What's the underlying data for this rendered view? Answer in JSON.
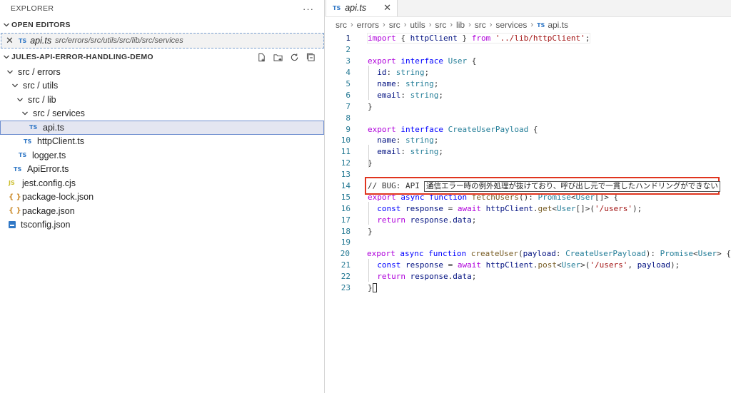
{
  "sidebar": {
    "title": "EXPLORER",
    "more_label": "···",
    "open_editors": {
      "title": "OPEN EDITORS",
      "item": {
        "close": "✕",
        "badge": "TS",
        "name": "api.ts",
        "path": "src/errors/src/utils/src/lib/src/services"
      }
    },
    "project": {
      "title": "JULES-API-ERROR-HANDLING-DEMO",
      "tree": [
        {
          "label": "src / errors",
          "type": "folder",
          "indent": 1
        },
        {
          "label": "src / utils",
          "type": "folder",
          "indent": 2
        },
        {
          "label": "src / lib",
          "type": "folder",
          "indent": 3
        },
        {
          "label": "src / services",
          "type": "folder",
          "indent": 4
        },
        {
          "label": "api.ts",
          "type": "ts",
          "indent": 5,
          "selected": true
        },
        {
          "label": "httpClient.ts",
          "type": "ts",
          "indent": 4
        },
        {
          "label": "logger.ts",
          "type": "ts",
          "indent": 3
        },
        {
          "label": "ApiError.ts",
          "type": "ts",
          "indent": 2
        },
        {
          "label": "jest.config.cjs",
          "type": "js",
          "indent": 1
        },
        {
          "label": "package-lock.json",
          "type": "json",
          "indent": 1
        },
        {
          "label": "package.json",
          "type": "json",
          "indent": 1
        },
        {
          "label": "tsconfig.json",
          "type": "tsconfig",
          "indent": 1
        }
      ]
    }
  },
  "editor": {
    "tab": {
      "badge": "TS",
      "label": "api.ts",
      "close": "✕"
    },
    "breadcrumb": [
      "src",
      "errors",
      "src",
      "utils",
      "src",
      "lib",
      "src",
      "services",
      "api.ts"
    ],
    "breadcrumb_badge": "TS",
    "comment_overlay": "通信エラー時の例外処理が抜けており、呼び出し元で一貫したハンドリングができない",
    "lines": [
      [
        [
          "kw",
          "import"
        ],
        [
          "pu",
          " { "
        ],
        [
          "id",
          "httpClient"
        ],
        [
          "pu",
          " } "
        ],
        [
          "kw",
          "from"
        ],
        [
          "pu",
          " "
        ],
        [
          "str",
          "'../lib/httpClient'"
        ],
        [
          "pu",
          ";"
        ]
      ],
      [],
      [
        [
          "kw",
          "export"
        ],
        [
          "pu",
          " "
        ],
        [
          "kw2",
          "interface"
        ],
        [
          "pu",
          " "
        ],
        [
          "ty",
          "User"
        ],
        [
          "pu",
          " {"
        ]
      ],
      [
        [
          "pu",
          "  "
        ],
        [
          "id",
          "id"
        ],
        [
          "pu",
          ": "
        ],
        [
          "ty",
          "string"
        ],
        [
          "pu",
          ";"
        ]
      ],
      [
        [
          "pu",
          "  "
        ],
        [
          "id",
          "name"
        ],
        [
          "pu",
          ": "
        ],
        [
          "ty",
          "string"
        ],
        [
          "pu",
          ";"
        ]
      ],
      [
        [
          "pu",
          "  "
        ],
        [
          "id",
          "email"
        ],
        [
          "pu",
          ": "
        ],
        [
          "ty",
          "string"
        ],
        [
          "pu",
          ";"
        ]
      ],
      [
        [
          "pu",
          "}"
        ]
      ],
      [],
      [
        [
          "kw",
          "export"
        ],
        [
          "pu",
          " "
        ],
        [
          "kw2",
          "interface"
        ],
        [
          "pu",
          " "
        ],
        [
          "ty",
          "CreateUserPayload"
        ],
        [
          "pu",
          " {"
        ]
      ],
      [
        [
          "pu",
          "  "
        ],
        [
          "id",
          "name"
        ],
        [
          "pu",
          ": "
        ],
        [
          "ty",
          "string"
        ],
        [
          "pu",
          ";"
        ]
      ],
      [
        [
          "pu",
          "  "
        ],
        [
          "id",
          "email"
        ],
        [
          "pu",
          ": "
        ],
        [
          "ty",
          "string"
        ],
        [
          "pu",
          ";"
        ]
      ],
      [
        [
          "pu",
          "}"
        ]
      ],
      [],
      [
        [
          "cm",
          "// BUG: API "
        ]
      ],
      [
        [
          "kw",
          "export"
        ],
        [
          "pu",
          " "
        ],
        [
          "kw2",
          "async"
        ],
        [
          "pu",
          " "
        ],
        [
          "kw2",
          "function"
        ],
        [
          "pu",
          " "
        ],
        [
          "fn",
          "fetchUsers"
        ],
        [
          "pu",
          "(): "
        ],
        [
          "ty",
          "Promise"
        ],
        [
          "pu",
          "<"
        ],
        [
          "ty",
          "User"
        ],
        [
          "pu",
          "[]> {"
        ]
      ],
      [
        [
          "pu",
          "  "
        ],
        [
          "kw2",
          "const"
        ],
        [
          "pu",
          " "
        ],
        [
          "id",
          "response"
        ],
        [
          "pu",
          " = "
        ],
        [
          "kw",
          "await"
        ],
        [
          "pu",
          " "
        ],
        [
          "id",
          "httpClient"
        ],
        [
          "pu",
          "."
        ],
        [
          "fn",
          "get"
        ],
        [
          "pu",
          "<"
        ],
        [
          "ty",
          "User"
        ],
        [
          "pu",
          "[]>("
        ],
        [
          "str",
          "'/users'"
        ],
        [
          "pu",
          ");"
        ]
      ],
      [
        [
          "pu",
          "  "
        ],
        [
          "kw",
          "return"
        ],
        [
          "pu",
          " "
        ],
        [
          "id",
          "response"
        ],
        [
          "pu",
          "."
        ],
        [
          "id",
          "data"
        ],
        [
          "pu",
          ";"
        ]
      ],
      [
        [
          "pu",
          "}"
        ]
      ],
      [],
      [
        [
          "kw",
          "export"
        ],
        [
          "pu",
          " "
        ],
        [
          "kw2",
          "async"
        ],
        [
          "pu",
          " "
        ],
        [
          "kw2",
          "function"
        ],
        [
          "pu",
          " "
        ],
        [
          "fn",
          "createUser"
        ],
        [
          "pu",
          "("
        ],
        [
          "id",
          "payload"
        ],
        [
          "pu",
          ": "
        ],
        [
          "ty",
          "CreateUserPayload"
        ],
        [
          "pu",
          "): "
        ],
        [
          "ty",
          "Promise"
        ],
        [
          "pu",
          "<"
        ],
        [
          "ty",
          "User"
        ],
        [
          "pu",
          "> {"
        ]
      ],
      [
        [
          "pu",
          "  "
        ],
        [
          "kw2",
          "const"
        ],
        [
          "pu",
          " "
        ],
        [
          "id",
          "response"
        ],
        [
          "pu",
          " = "
        ],
        [
          "kw",
          "await"
        ],
        [
          "pu",
          " "
        ],
        [
          "id",
          "httpClient"
        ],
        [
          "pu",
          "."
        ],
        [
          "fn",
          "post"
        ],
        [
          "pu",
          "<"
        ],
        [
          "ty",
          "User"
        ],
        [
          "pu",
          ">("
        ],
        [
          "str",
          "'/users'"
        ],
        [
          "pu",
          ", "
        ],
        [
          "id",
          "payload"
        ],
        [
          "pu",
          ");"
        ]
      ],
      [
        [
          "pu",
          "  "
        ],
        [
          "kw",
          "return"
        ],
        [
          "pu",
          " "
        ],
        [
          "id",
          "response"
        ],
        [
          "pu",
          "."
        ],
        [
          "id",
          "data"
        ],
        [
          "pu",
          ";"
        ]
      ],
      [
        [
          "pu",
          "}"
        ]
      ]
    ]
  },
  "colors": {
    "highlight_border": "#e0341e",
    "ts_icon": "#3178c6",
    "line_number": "#237893",
    "selection_border": "#6f8fd0"
  }
}
